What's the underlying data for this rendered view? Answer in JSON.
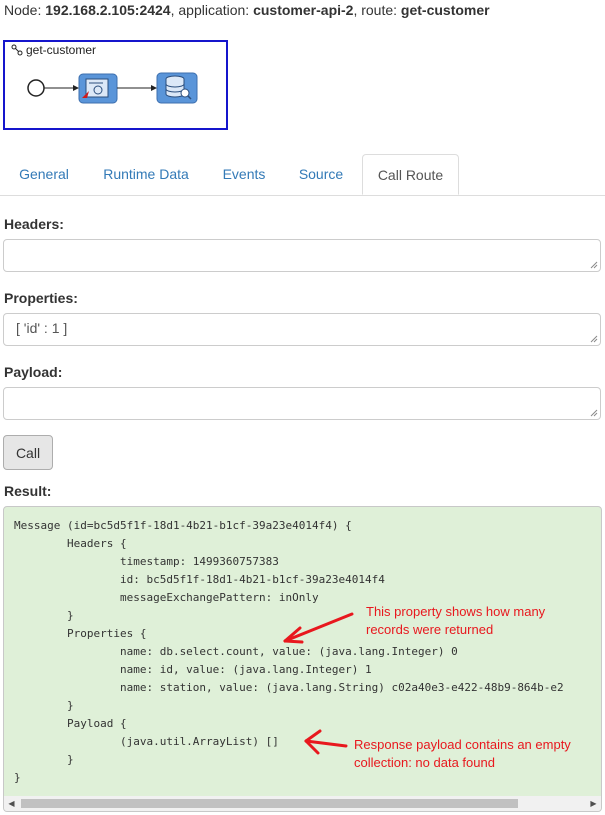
{
  "header": {
    "node_prefix": "Node: ",
    "node": "192.168.2.105:2424",
    "app_prefix": ", application: ",
    "application": "customer-api-2",
    "route_prefix": ", route: ",
    "route": "get-customer"
  },
  "route_diagram": {
    "title": "get-customer"
  },
  "tabs": [
    {
      "label": "General"
    },
    {
      "label": "Runtime Data"
    },
    {
      "label": "Events"
    },
    {
      "label": "Source"
    },
    {
      "label": "Call Route",
      "active": true
    }
  ],
  "form": {
    "headers_label": "Headers:",
    "headers_value": "",
    "properties_label": "Properties:",
    "properties_value": "[ 'id' : 1 ]",
    "payload_label": "Payload:",
    "payload_value": "",
    "call_button": "Call"
  },
  "result": {
    "label": "Result:",
    "text": "Message (id=bc5d5f1f-18d1-4b21-b1cf-39a23e4014f4) {\n        Headers {\n                timestamp: 1499360757383\n                id: bc5d5f1f-18d1-4b21-b1cf-39a23e4014f4\n                messageExchangePattern: inOnly\n        }\n        Properties {\n                name: db.select.count, value: (java.lang.Integer) 0\n                name: id, value: (java.lang.Integer) 1\n                name: station, value: (java.lang.String) c02a40e3-e422-48b9-864b-e2\n        }\n        Payload {\n                (java.util.ArrayList) []\n        }\n}"
  },
  "annotations": {
    "property_note_1": "This property shows how many",
    "property_note_2": "records were returned",
    "payload_note_1": "Response payload contains an empty",
    "payload_note_2": "collection: no data found"
  },
  "colors": {
    "link": "#337ab7",
    "result_bg": "#dff0d8",
    "annotation": "#e8181e",
    "route_border": "#1515cc"
  }
}
